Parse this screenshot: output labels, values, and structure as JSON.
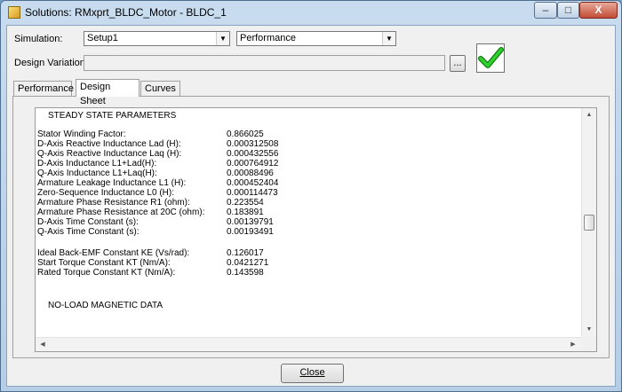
{
  "window": {
    "title": "Solutions: RMxprt_BLDC_Motor - BLDC_1",
    "min_glyph": "–",
    "max_glyph": "□",
    "close_glyph": "X",
    "icon": "app-icon"
  },
  "form": {
    "simulation_label": "Simulation:",
    "simulation_value": "Setup1",
    "type_value": "Performance",
    "design_variation_label": "Design Variation:",
    "design_variation_value": "",
    "ellipsis_label": "...",
    "status_icon": "checkmark-icon",
    "status_color": "#1fb81f"
  },
  "tabs": [
    {
      "label": "Performance",
      "active": false
    },
    {
      "label": "Design Sheet",
      "active": true
    },
    {
      "label": "Curves",
      "active": false
    }
  ],
  "sheet": {
    "steady_state_heading": "STEADY STATE PARAMETERS",
    "rows_1": [
      {
        "name": "Stator Winding Factor:",
        "value": "0.866025"
      },
      {
        "name": "D-Axis Reactive Inductance Lad (H):",
        "value": "0.000312508"
      },
      {
        "name": "Q-Axis Reactive Inductance Laq (H):",
        "value": "0.000432556"
      },
      {
        "name": "D-Axis Inductance L1+Lad(H):",
        "value": "0.000764912"
      },
      {
        "name": "Q-Axis Inductance L1+Laq(H):",
        "value": "0.00088496"
      },
      {
        "name": "Armature Leakage Inductance L1 (H):",
        "value": "0.000452404"
      },
      {
        "name": "Zero-Sequence Inductance L0 (H):",
        "value": "0.000114473"
      },
      {
        "name": "Armature Phase Resistance R1 (ohm):",
        "value": "0.223554"
      },
      {
        "name": "Armature Phase Resistance at 20C (ohm):",
        "value": "0.183891"
      },
      {
        "name": "D-Axis Time Constant (s):",
        "value": "0.00139791"
      },
      {
        "name": "Q-Axis Time Constant (s):",
        "value": "0.00193491"
      }
    ],
    "rows_2": [
      {
        "name": "Ideal Back-EMF Constant KE (Vs/rad):",
        "value": "0.126017"
      },
      {
        "name": "Start Torque Constant KT (Nm/A):",
        "value": "0.0421271"
      },
      {
        "name": "Rated Torque Constant KT (Nm/A):",
        "value": "0.143598"
      }
    ],
    "no_load_heading": "NO-LOAD MAGNETIC DATA"
  },
  "footer": {
    "close_label": "Close"
  }
}
